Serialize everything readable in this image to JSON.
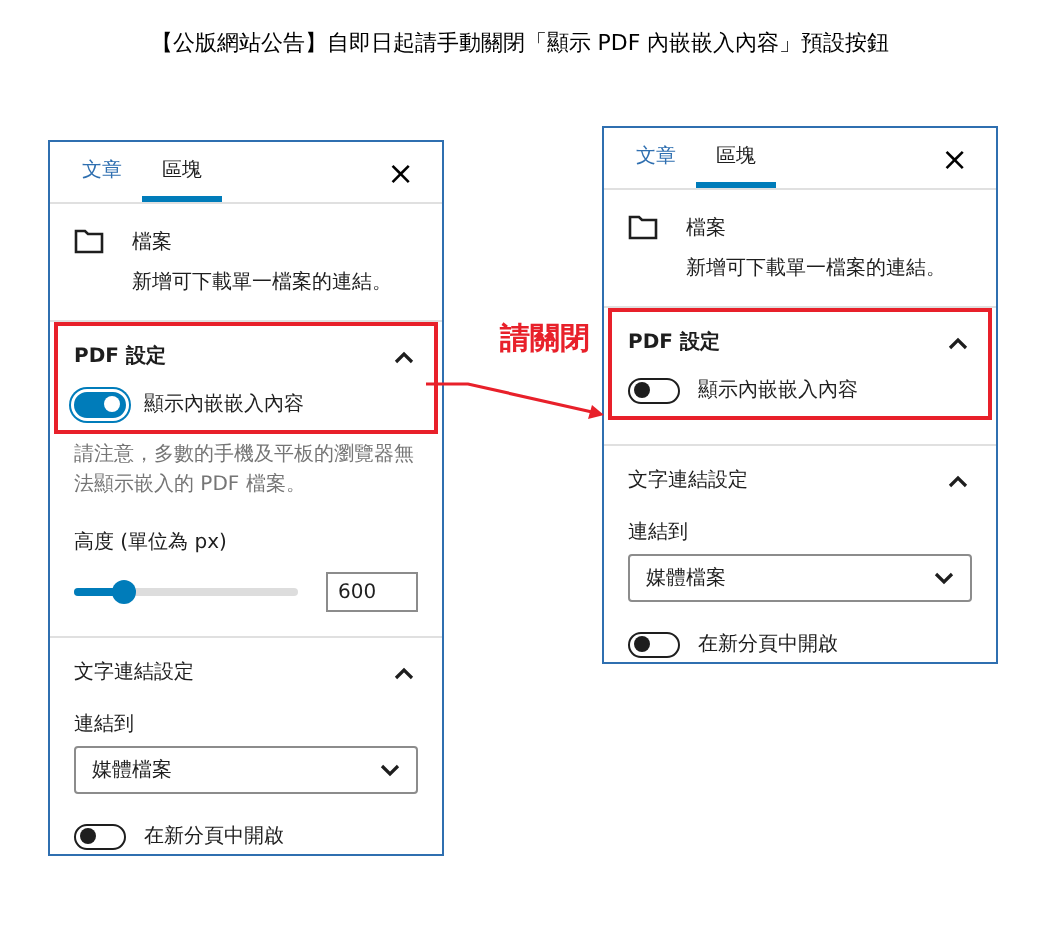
{
  "title": "【公版網站公告】自即日起請手動關閉「顯示 PDF 內嵌嵌入內容」預設按鈕",
  "annotation": {
    "label": "請關閉"
  },
  "panels": [
    {
      "tabs": [
        {
          "label": "文章",
          "selected": false
        },
        {
          "label": "區塊",
          "selected": true
        }
      ],
      "close": "×",
      "file": {
        "title": "檔案",
        "description": "新增可下載單一檔案的連結。"
      },
      "pdf": {
        "title": "PDF 設定",
        "expanded": true,
        "highlighted": true,
        "toggle": {
          "label": "顯示內嵌嵌入內容",
          "on": true
        },
        "note": "請注意，多數的手機及平板的瀏覽器無法顯示嵌入的 PDF 檔案。",
        "height": {
          "label": "高度 (單位為 px)",
          "level": 0.22,
          "value": "600"
        }
      },
      "link": {
        "title": "文字連結設定",
        "expanded": true,
        "link_to": {
          "label": "連結到",
          "value": "媒體檔案"
        },
        "new_tab": {
          "label": "在新分頁中開啟",
          "on": false
        }
      }
    },
    {
      "tabs": [
        {
          "label": "文章",
          "selected": false
        },
        {
          "label": "區塊",
          "selected": true
        }
      ],
      "close": "×",
      "file": {
        "title": "檔案",
        "description": "新增可下載單一檔案的連結。"
      },
      "pdf": {
        "title": "PDF 設定",
        "expanded": true,
        "highlighted": true,
        "toggle": {
          "label": "顯示內嵌嵌入內容",
          "on": false
        }
      },
      "link": {
        "title": "文字連結設定",
        "expanded": true,
        "link_to": {
          "label": "連結到",
          "value": "媒體檔案"
        },
        "new_tab": {
          "label": "在新分頁中開啟",
          "on": false
        }
      }
    }
  ]
}
